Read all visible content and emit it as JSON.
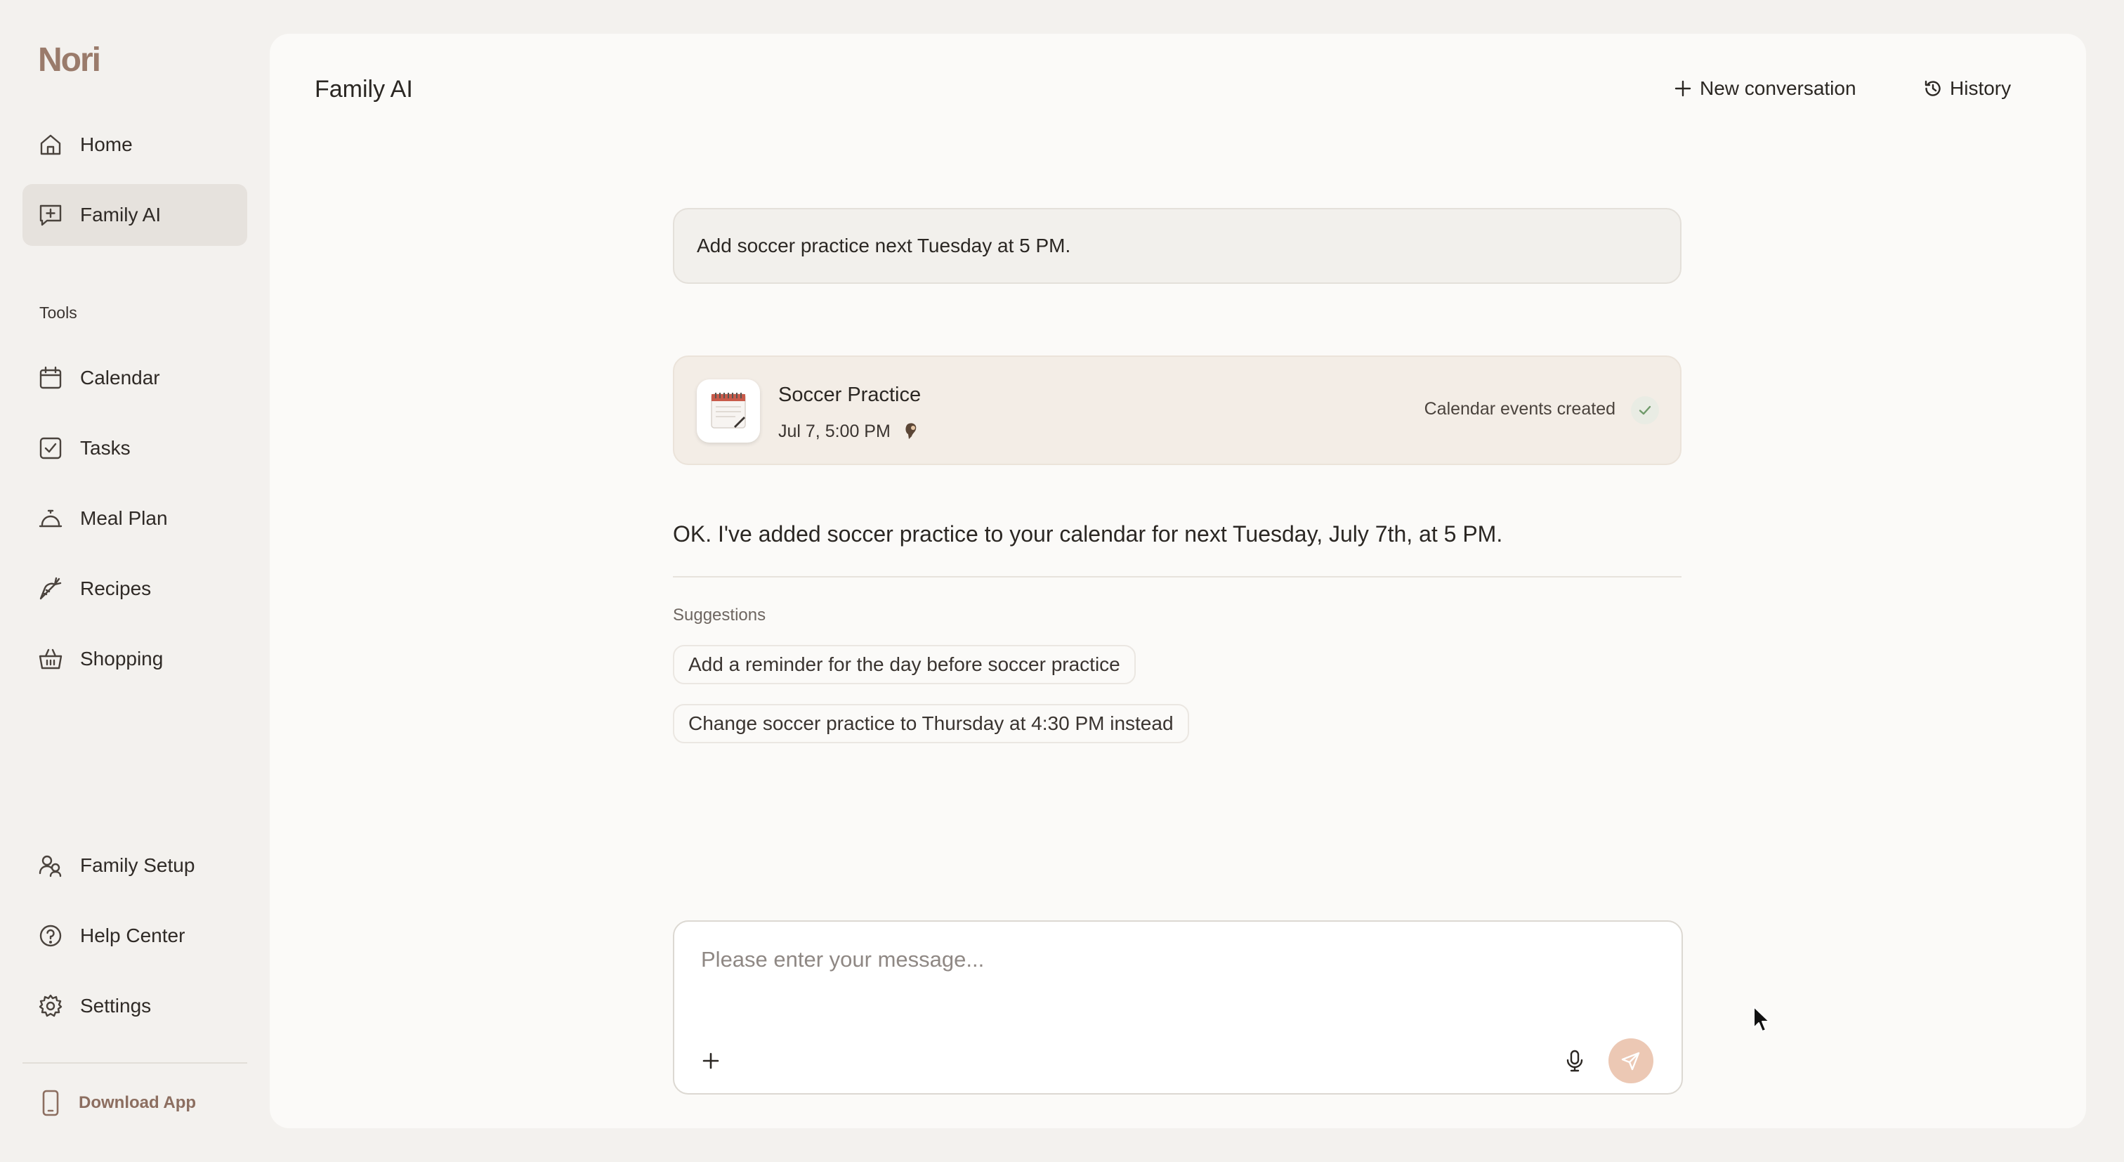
{
  "app": {
    "logo": "Nori"
  },
  "sidebar": {
    "top_items": [
      {
        "label": "Home",
        "icon": "home-icon"
      },
      {
        "label": "Family AI",
        "icon": "chat-plus-icon",
        "active": true
      }
    ],
    "tools_label": "Tools",
    "tools": [
      {
        "label": "Calendar",
        "icon": "calendar-icon"
      },
      {
        "label": "Tasks",
        "icon": "checkbox-icon"
      },
      {
        "label": "Meal Plan",
        "icon": "cloche-icon"
      },
      {
        "label": "Recipes",
        "icon": "carrot-icon"
      },
      {
        "label": "Shopping",
        "icon": "basket-icon"
      }
    ],
    "bottom_items": [
      {
        "label": "Family Setup",
        "icon": "family-icon"
      },
      {
        "label": "Help Center",
        "icon": "help-icon"
      },
      {
        "label": "Settings",
        "icon": "gear-icon"
      }
    ],
    "download_label": "Download App"
  },
  "header": {
    "title": "Family AI",
    "new_conversation": "New conversation",
    "history": "History"
  },
  "conversation": {
    "user_message": "Add soccer practice next Tuesday at 5 PM.",
    "event_card": {
      "title": "Soccer Practice",
      "time": "Jul 7, 5:00 PM",
      "status": "Calendar events created"
    },
    "ai_message": "OK. I've added soccer practice to your calendar for next Tuesday, July 7th, at 5 PM.",
    "suggestions_label": "Suggestions",
    "suggestions": [
      "Add a reminder for the day before soccer practice",
      "Change soccer practice to Thursday at 4:30 PM instead"
    ]
  },
  "composer": {
    "placeholder": "Please enter your message...",
    "value": ""
  },
  "colors": {
    "brand": "#9a7b6b",
    "send_button": "#ecc8b4",
    "active_nav": "#e6e2dd",
    "success_check": "#6f9a6a"
  }
}
